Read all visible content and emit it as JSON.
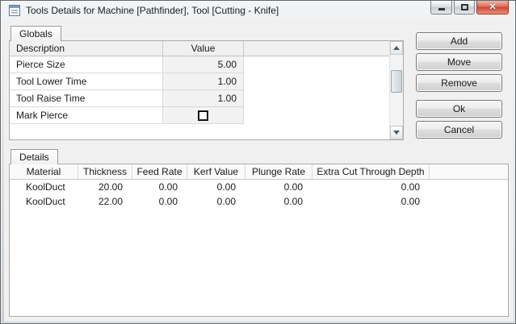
{
  "window": {
    "title": "Tools Details for Machine [Pathfinder], Tool [Cutting - Knife]"
  },
  "globals": {
    "tab": "Globals",
    "header": {
      "description": "Description",
      "value": "Value"
    },
    "rows": [
      {
        "description": "Pierce Size",
        "value": "5.00"
      },
      {
        "description": "Tool Lower Time",
        "value": "1.00"
      },
      {
        "description": "Tool Raise Time",
        "value": "1.00"
      },
      {
        "description": "Mark Pierce",
        "value_type": "checkbox",
        "checked": false
      }
    ]
  },
  "actions": {
    "add": "Add",
    "move": "Move",
    "remove": "Remove",
    "ok": "Ok",
    "cancel": "Cancel"
  },
  "details": {
    "tab": "Details",
    "columns": [
      "Material",
      "Thickness",
      "Feed Rate",
      "Kerf Value",
      "Plunge Rate",
      "Extra Cut Through Depth"
    ],
    "rows": [
      [
        "KoolDuct",
        "20.00",
        "0.00",
        "0.00",
        "0.00",
        "0.00"
      ],
      [
        "KoolDuct",
        "22.00",
        "0.00",
        "0.00",
        "0.00",
        "0.00"
      ]
    ]
  },
  "colors": {
    "close_button": "#cf4437",
    "dialog_background": "#f0f0f0",
    "window_frame": "#dfe3e7"
  }
}
